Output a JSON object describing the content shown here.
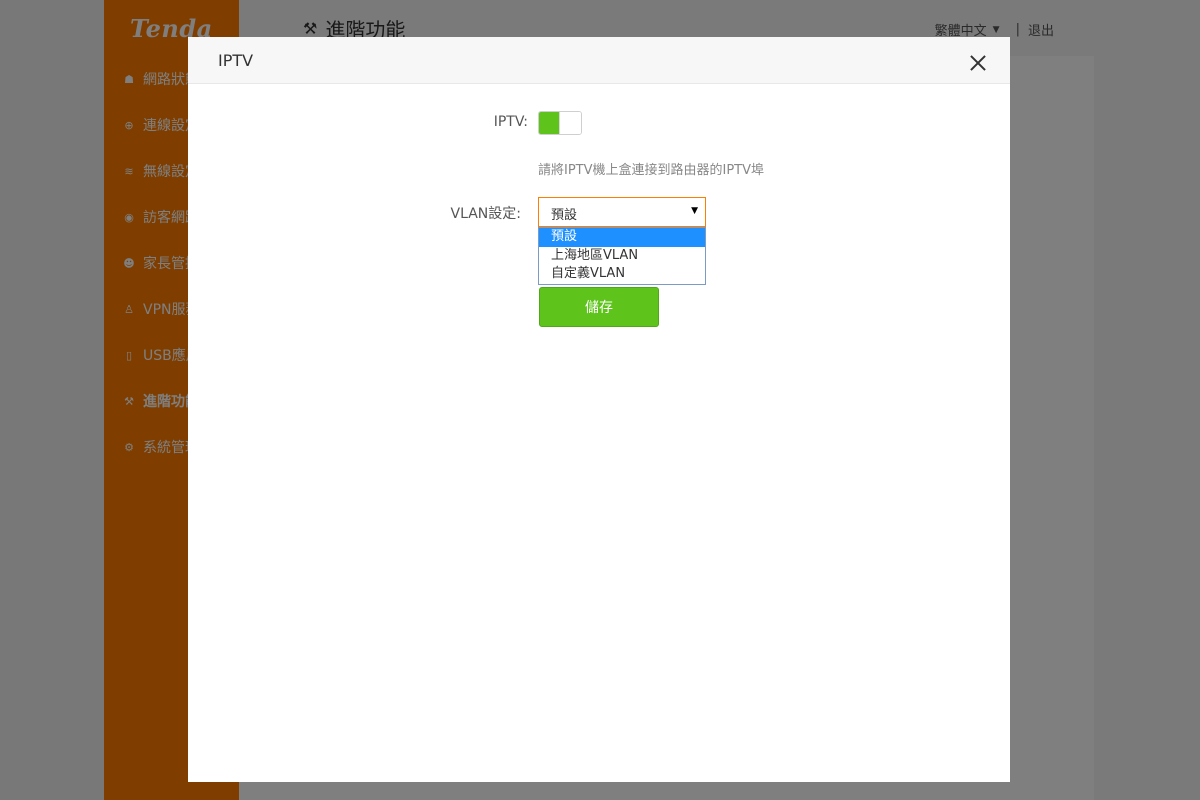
{
  "app": {
    "logo": "Tenda",
    "sidebar": {
      "items": [
        {
          "label": "網路狀態",
          "icon": "network-status-icon",
          "glyph": "☗"
        },
        {
          "label": "連線設定",
          "icon": "globe-icon",
          "glyph": "⊕"
        },
        {
          "label": "無線設定",
          "icon": "wifi-icon",
          "glyph": "≋"
        },
        {
          "label": "訪客網路",
          "icon": "location-pin-icon",
          "glyph": "◉"
        },
        {
          "label": "家長管控",
          "icon": "family-icon",
          "glyph": "☻"
        },
        {
          "label": "VPN服務",
          "icon": "person-icon",
          "glyph": "♙"
        },
        {
          "label": "USB應用",
          "icon": "usb-icon",
          "glyph": "▯"
        },
        {
          "label": "進階功能",
          "icon": "wrench-icon",
          "glyph": "⚒"
        },
        {
          "label": "系統管理",
          "icon": "gear-icon",
          "glyph": "⚙"
        }
      ],
      "active": "進階功能"
    },
    "page_title": "進階功能",
    "language": "繁體中文",
    "separator": "|",
    "logout": "退出"
  },
  "modal": {
    "title": "IPTV",
    "iptv_label": "IPTV:",
    "iptv_enabled": true,
    "hint": "請將IPTV機上盒連接到路由器的IPTV埠",
    "vlan_label": "VLAN設定:",
    "vlan_value": "預設",
    "vlan_options": [
      "預設",
      "上海地區VLAN",
      "自定義VLAN"
    ],
    "vlan_highlighted": "預設",
    "save_label": "儲存"
  },
  "colors": {
    "brand": "#ff7d00",
    "accent": "#5ec41c",
    "highlight": "#1e90ff"
  }
}
